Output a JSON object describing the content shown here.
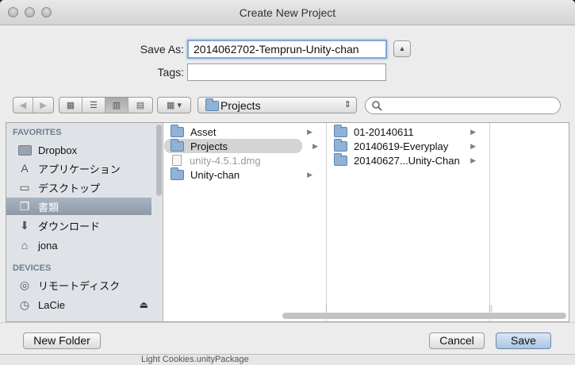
{
  "window": {
    "title": "Create New Project"
  },
  "form": {
    "save_as_label": "Save As:",
    "save_as_value": "2014062702-Temprun-Unity-chan",
    "tags_label": "Tags:",
    "tags_value": "",
    "expand_glyph": "▲"
  },
  "toolbar": {
    "back_glyph": "◀",
    "forward_glyph": "▶",
    "view_glyphs": [
      "▦",
      "☰",
      "▥",
      "▤"
    ],
    "arrange_glyph": "▦ ▾",
    "location": "Projects",
    "popup_glyph": "⇕",
    "search_placeholder": ""
  },
  "sidebar": {
    "favorites_heading": "FAVORITES",
    "favorites": [
      {
        "label": "Dropbox",
        "icon": "dropbox-folder-icon"
      },
      {
        "label": "アプリケーション",
        "icon": "applications-icon",
        "glyph": "A"
      },
      {
        "label": "デスクトップ",
        "icon": "desktop-icon",
        "glyph": "▭"
      },
      {
        "label": "書類",
        "icon": "documents-icon",
        "glyph": "❐",
        "selected": true
      },
      {
        "label": "ダウンロード",
        "icon": "downloads-icon",
        "glyph": "⬇"
      },
      {
        "label": "jona",
        "icon": "home-icon",
        "glyph": "⌂"
      }
    ],
    "devices_heading": "DEVICES",
    "devices": [
      {
        "label": "リモートディスク",
        "icon": "remote-disc-icon",
        "glyph": "◎"
      },
      {
        "label": "LaCie",
        "icon": "drive-icon",
        "glyph": "◷",
        "eject_glyph": "⏏"
      }
    ]
  },
  "columns": [
    {
      "items": [
        {
          "label": "Asset",
          "type": "folder",
          "has_children": true
        },
        {
          "label": "Projects",
          "type": "folder",
          "has_children": true,
          "selected": true
        },
        {
          "label": "unity-4.5.1.dmg",
          "type": "file",
          "dimmed": true
        },
        {
          "label": "Unity-chan",
          "type": "folder",
          "has_children": true
        }
      ]
    },
    {
      "items": [
        {
          "label": "01-20140611",
          "type": "folder",
          "has_children": true
        },
        {
          "label": "20140619-Everyplay",
          "type": "folder",
          "has_children": true
        },
        {
          "label": "20140627...Unity-Chan",
          "type": "folder",
          "has_children": true
        }
      ]
    }
  ],
  "arrow_glyph": "▶",
  "resize_glyph": "||",
  "footer": {
    "new_folder_label": "New Folder",
    "cancel_label": "Cancel",
    "save_label": "Save"
  },
  "background_text": "Light Cookies.unityPackage"
}
